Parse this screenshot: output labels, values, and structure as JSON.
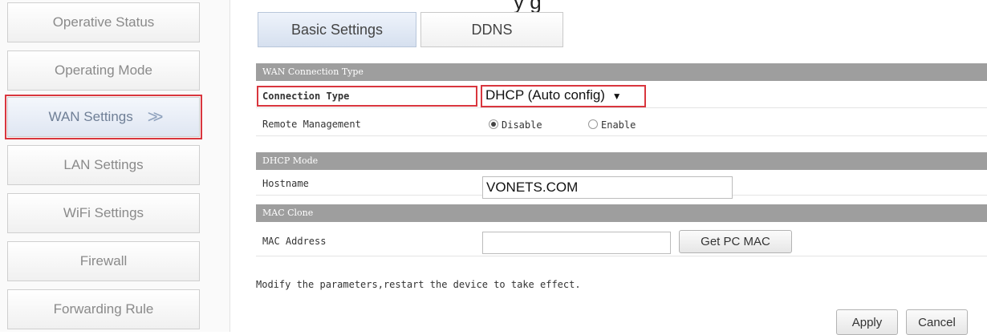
{
  "top_cut_text": "y                                  g",
  "sidebar": {
    "items": [
      {
        "label": "Operative Status"
      },
      {
        "label": "Operating Mode"
      },
      {
        "label": "WAN Settings",
        "active": true,
        "chevron": ">>"
      },
      {
        "label": "LAN Settings"
      },
      {
        "label": "WiFi Settings"
      },
      {
        "label": "Firewall"
      },
      {
        "label": "Forwarding Rule"
      }
    ]
  },
  "tabs": [
    {
      "label": "Basic Settings",
      "active": true
    },
    {
      "label": "DDNS"
    }
  ],
  "wan": {
    "section_title": "WAN Connection Type",
    "connection_type_label": "Connection Type",
    "connection_type_value": "DHCP (Auto config)",
    "dropdown_arrow": "▼",
    "remote_management_label": "Remote Management",
    "radio_disable": "Disable",
    "radio_enable": "Enable"
  },
  "dhcp": {
    "section_title": "DHCP Mode",
    "hostname_label": "Hostname",
    "hostname_value": "VONETS.COM"
  },
  "mac": {
    "section_title": "MAC Clone",
    "mac_address_label": "MAC Address",
    "mac_address_value": "",
    "get_pc_mac_button": "Get PC MAC"
  },
  "note": "Modify the parameters,restart the device to take effect.",
  "actions": {
    "apply": "Apply",
    "cancel": "Cancel"
  },
  "colors": {
    "highlight": "#d9363e",
    "section_header": "#9e9e9e",
    "active_tab": "#d6e0ef"
  }
}
